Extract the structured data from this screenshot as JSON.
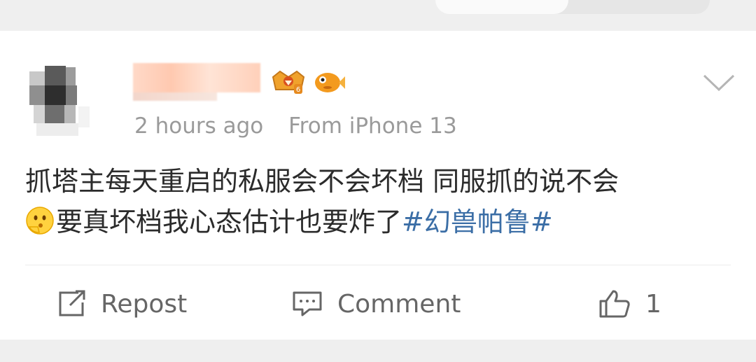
{
  "post": {
    "meta": {
      "time": "2 hours ago",
      "source": "From iPhone 13"
    },
    "text": {
      "part1": "抓塔主每天重启的私服会不会坏档 同服抓的说不会",
      "part2": "要真坏档我心态估计也要炸了",
      "hashtag": "#幻兽帕鲁#"
    },
    "actions": {
      "repost_label": "Repost",
      "comment_label": "Comment",
      "like_count": "1"
    }
  },
  "colors": {
    "hashtag": "#3b6ea6",
    "meta": "#9a9a9a",
    "text": "#2b2b2b"
  },
  "icons": [
    "crown-badge-icon",
    "fish-badge-icon",
    "chevron-down-icon",
    "thinking-emoji-icon",
    "repost-icon",
    "comment-icon",
    "like-icon"
  ]
}
